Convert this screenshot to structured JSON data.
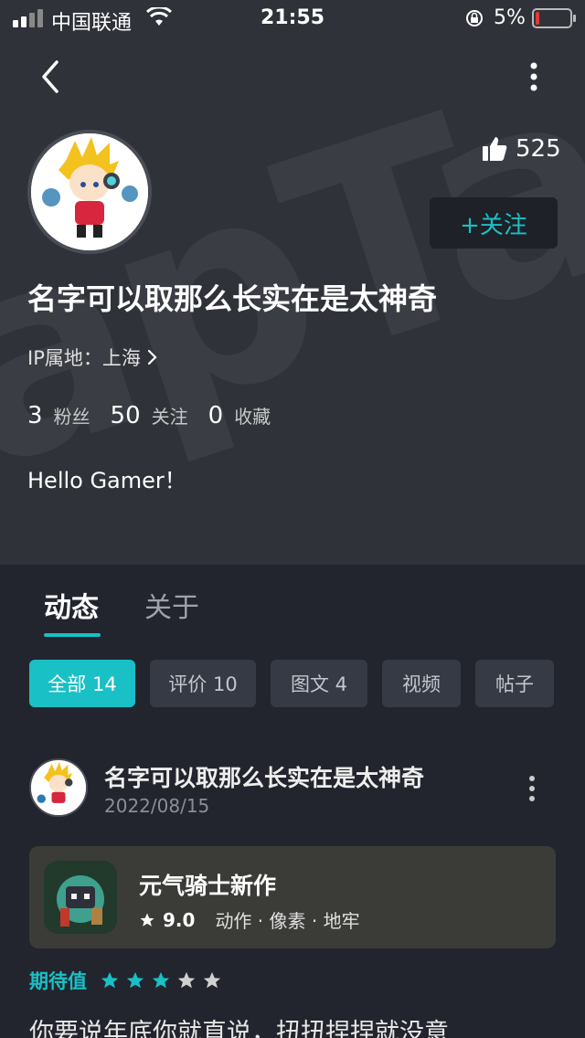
{
  "status_bar": {
    "carrier": "中国联通",
    "time": "21:55",
    "battery": "5%"
  },
  "profile": {
    "likes": "525",
    "follow_label": "+关注",
    "username": "名字可以取那么长实在是太神奇",
    "ip_location": "IP属地：上海",
    "stats": [
      {
        "value": "3",
        "label": "粉丝"
      },
      {
        "value": "50",
        "label": "关注"
      },
      {
        "value": "0",
        "label": "收藏"
      }
    ],
    "bio": "Hello Gamer！"
  },
  "tabs": [
    {
      "label": "动态"
    },
    {
      "label": "关于"
    }
  ],
  "filters": [
    {
      "label": "全部 14"
    },
    {
      "label": "评价 10"
    },
    {
      "label": "图文 4"
    },
    {
      "label": "视频"
    },
    {
      "label": "帖子"
    }
  ],
  "post": {
    "author": "名字可以取那么长实在是太神奇",
    "date": "2022/08/15",
    "game": {
      "title": "元气骑士新作",
      "score": "9.0",
      "tags": "动作 · 像素 · 地牢"
    },
    "expectation_label": "期待值",
    "expectation_rating": 3,
    "expectation_max": 5,
    "text": "你要说年底你就直说，扭扭捏捏就没意"
  },
  "colors": {
    "accent": "#19c0c5",
    "header_bg": "#2f3239",
    "page_bg": "#22252d"
  }
}
